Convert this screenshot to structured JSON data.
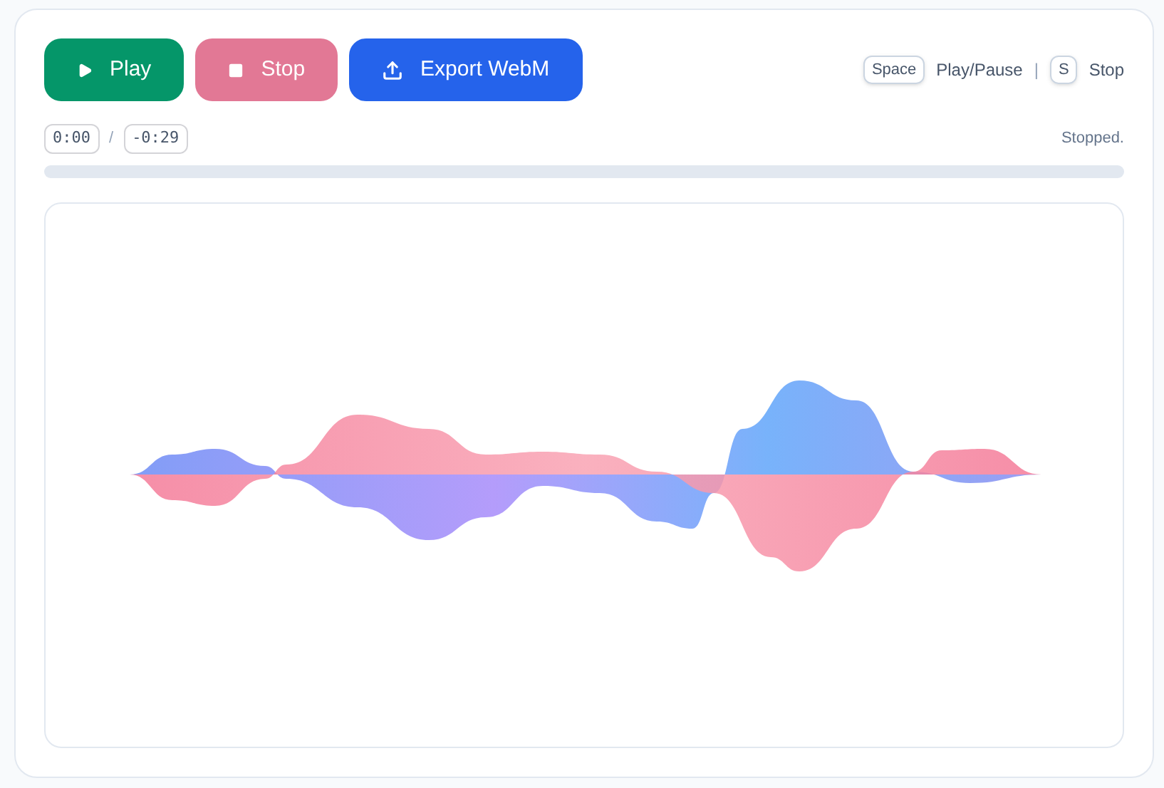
{
  "buttons": [
    {
      "kind": "play",
      "label": "Play"
    },
    {
      "kind": "stop",
      "label": "Stop"
    },
    {
      "kind": "export",
      "label": "Export WebM"
    }
  ],
  "shortcuts": [
    {
      "key": "Space",
      "action": "Play/Pause"
    },
    {
      "key": "S",
      "action": "Stop"
    }
  ],
  "shortcut_separator": "|",
  "time": {
    "elapsed": "0:00",
    "separator": "/",
    "remaining": "-0:29"
  },
  "status": "Stopped.",
  "progress": {
    "level": 0
  }
}
